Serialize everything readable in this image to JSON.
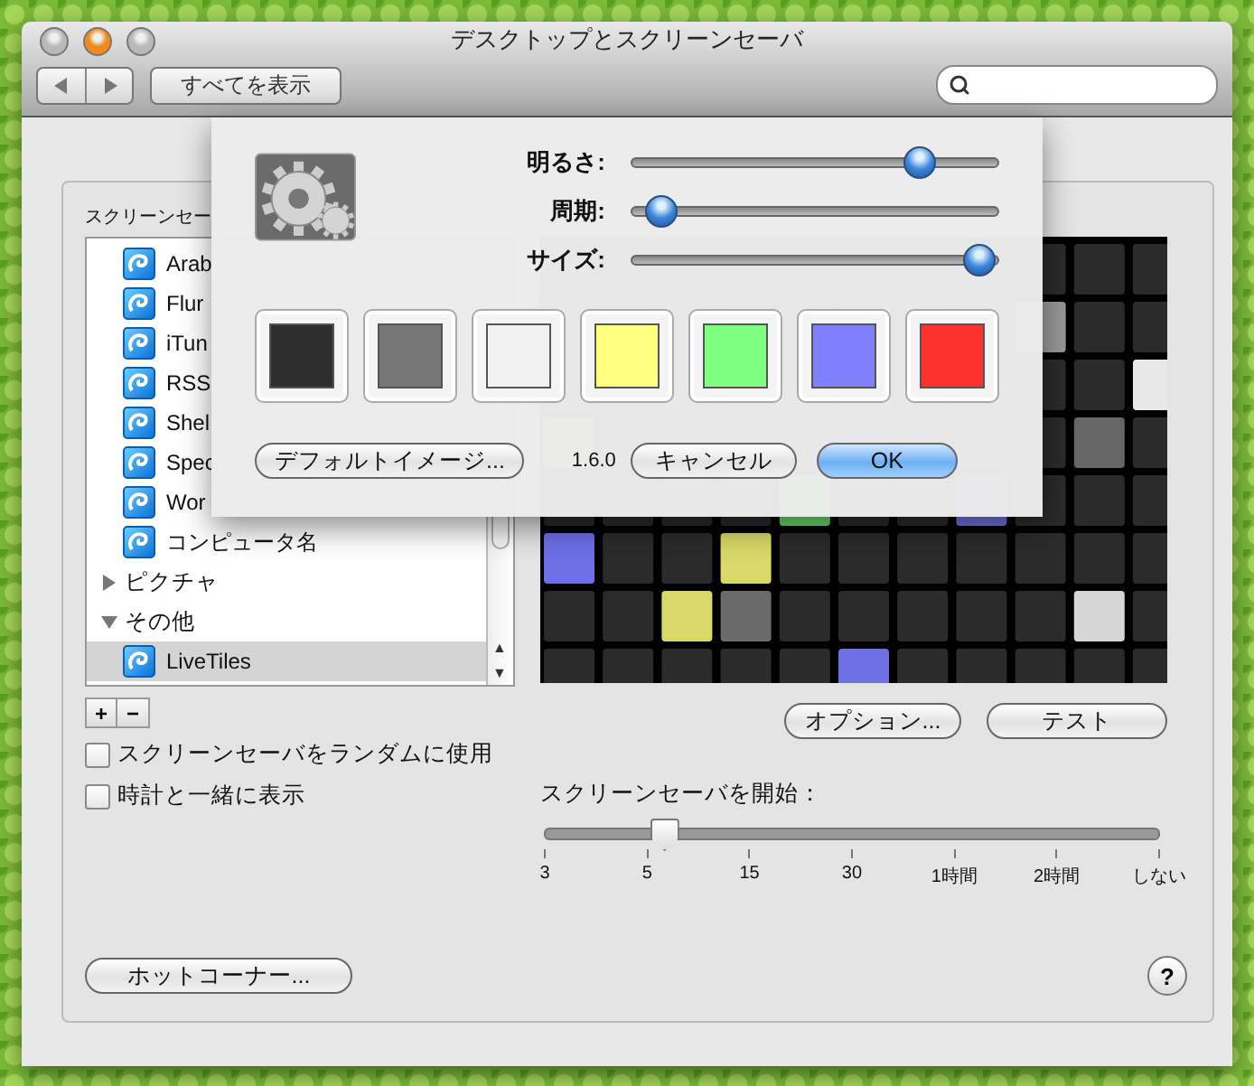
{
  "window": {
    "title": "デスクトップとスクリーンセーバ"
  },
  "toolbar": {
    "show_all": "すべてを表示"
  },
  "list_label": "スクリーンセー",
  "screen_savers": [
    {
      "kind": "item",
      "name": "Arab",
      "selected": false
    },
    {
      "kind": "item",
      "name": "Flur",
      "selected": false
    },
    {
      "kind": "item",
      "name": "iTun",
      "selected": false
    },
    {
      "kind": "item",
      "name": "RSS",
      "selected": false
    },
    {
      "kind": "item",
      "name": "Shel",
      "selected": false
    },
    {
      "kind": "item",
      "name": "Spec",
      "selected": false
    },
    {
      "kind": "item",
      "name": "Wor",
      "selected": false
    },
    {
      "kind": "item",
      "name": "コンピュータ名",
      "selected": false
    },
    {
      "kind": "group",
      "name": "ピクチャ",
      "expanded": false
    },
    {
      "kind": "group",
      "name": "その他",
      "expanded": true,
      "children": [
        {
          "kind": "item",
          "name": "LiveTiles",
          "selected": true
        }
      ]
    }
  ],
  "list_buttons": [
    "+",
    "−"
  ],
  "scroll_arrows": [
    "▲",
    "▼"
  ],
  "checkboxes": [
    {
      "label": "スクリーンセーバをランダムに使用",
      "checked": false
    },
    {
      "label": "時計と一緒に表示",
      "checked": false
    }
  ],
  "options_button": "オプション...",
  "test_button": "テスト",
  "start": {
    "label": "スクリーンセーバを開始：",
    "level": 0.18,
    "ticks": [
      "3",
      "5",
      "15",
      "30",
      "1時間",
      "2時間",
      "しない"
    ]
  },
  "hot_corners_button": "ホットコーナー...",
  "help_button": "?",
  "sheet": {
    "sliders": [
      {
        "label": "明るさ:",
        "level": 0.79
      },
      {
        "label": "周期:",
        "level": 0.06
      },
      {
        "label": "サイズ:",
        "level": 0.96
      }
    ],
    "swatches": [
      {
        "color": "#2e2e2e"
      },
      {
        "color": "#777777"
      },
      {
        "color": "#f2f2f2"
      },
      {
        "color": "#ffff80"
      },
      {
        "color": "#80ff80"
      },
      {
        "color": "#8080ff"
      },
      {
        "color": "#ff3030"
      }
    ],
    "default_image_button": "デフォルトイメージ...",
    "version": "1.6.0",
    "cancel_button": "キャンセル",
    "ok_button": "OK"
  }
}
